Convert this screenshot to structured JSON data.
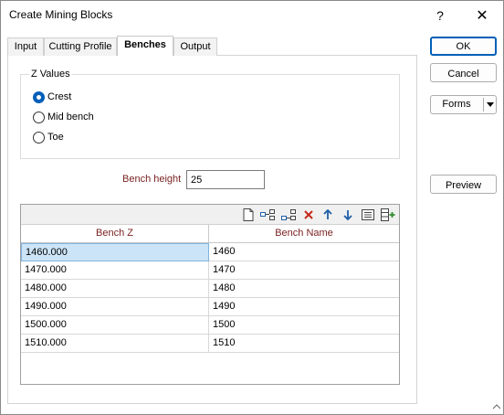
{
  "window": {
    "title": "Create Mining Blocks",
    "help_label": "?",
    "close_label": "✕"
  },
  "tabs": [
    {
      "label": "Input",
      "active": false
    },
    {
      "label": "Cutting Profile",
      "active": false
    },
    {
      "label": "Benches",
      "active": true
    },
    {
      "label": "Output",
      "active": false
    }
  ],
  "z_values": {
    "group_label": "Z Values",
    "options": [
      {
        "label": "Crest",
        "checked": true
      },
      {
        "label": "Mid bench",
        "checked": false
      },
      {
        "label": "Toe",
        "checked": false
      }
    ]
  },
  "bench_height": {
    "label": "Bench height",
    "value": "25"
  },
  "grid": {
    "toolbar_icons": [
      "new-icon",
      "insert-row-icon",
      "append-row-icon",
      "delete-icon",
      "move-up-icon",
      "move-down-icon",
      "list-icon",
      "add-column-icon"
    ],
    "columns": [
      "Bench Z",
      "Bench Name"
    ],
    "rows": [
      {
        "bench_z": "1460.000",
        "bench_name": "1460"
      },
      {
        "bench_z": "1470.000",
        "bench_name": "1470"
      },
      {
        "bench_z": "1480.000",
        "bench_name": "1480"
      },
      {
        "bench_z": "1490.000",
        "bench_name": "1490"
      },
      {
        "bench_z": "1500.000",
        "bench_name": "1500"
      },
      {
        "bench_z": "1510.000",
        "bench_name": "1510"
      }
    ]
  },
  "buttons": {
    "ok": "OK",
    "cancel": "Cancel",
    "forms": "Forms",
    "preview": "Preview"
  },
  "colors": {
    "accent": "#005fb8",
    "field_label": "#7a1f1f",
    "delete_icon": "#c42b1c",
    "arrow_icon": "#1f5fa8",
    "selection": "#cce4f7"
  }
}
